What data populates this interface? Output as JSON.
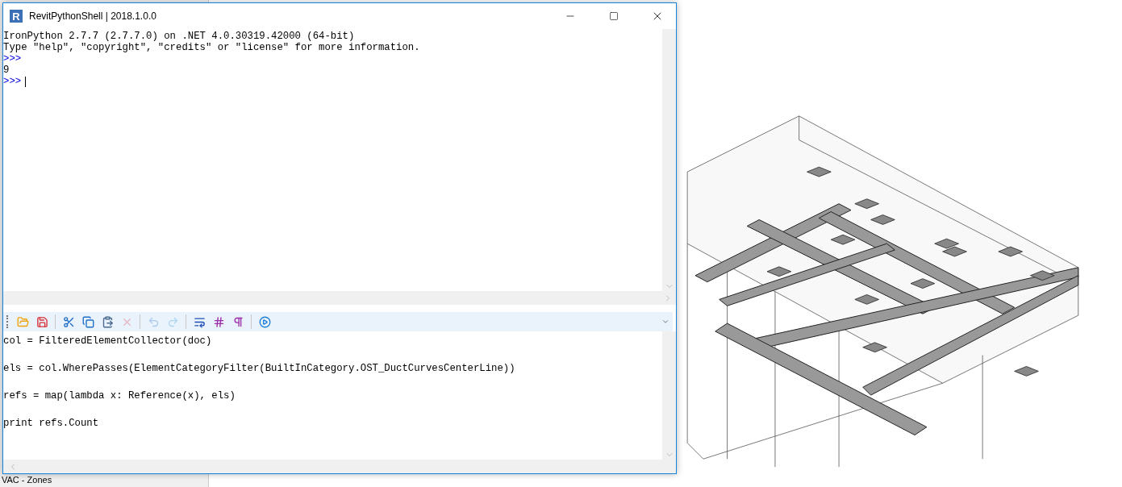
{
  "window": {
    "logo": "R",
    "title": "RevitPythonShell | 2018.1.0.0"
  },
  "output": [
    {
      "kind": "text",
      "text": "IronPython 2.7.7 (2.7.7.0) on .NET 4.0.30319.42000 (64-bit)"
    },
    {
      "kind": "text",
      "text": "Type \"help\", \"copyright\", \"credits\" or \"license\" for more information."
    },
    {
      "kind": "prompt",
      "text": ">>>"
    },
    {
      "kind": "text",
      "text": "9"
    },
    {
      "kind": "prompt",
      "text": ">>>"
    }
  ],
  "toolbar": [
    {
      "kind": "open",
      "disabled": false
    },
    {
      "kind": "save",
      "disabled": false
    },
    {
      "kind": "sep"
    },
    {
      "kind": "cut",
      "disabled": false
    },
    {
      "kind": "copy",
      "disabled": false
    },
    {
      "kind": "paste",
      "disabled": false
    },
    {
      "kind": "delete",
      "disabled": true
    },
    {
      "kind": "sep"
    },
    {
      "kind": "undo",
      "disabled": true
    },
    {
      "kind": "redo",
      "disabled": true
    },
    {
      "kind": "sep"
    },
    {
      "kind": "wrap",
      "disabled": false
    },
    {
      "kind": "hash",
      "disabled": false
    },
    {
      "kind": "pilcrow",
      "disabled": false
    },
    {
      "kind": "sep"
    },
    {
      "kind": "run",
      "disabled": false
    }
  ],
  "editor": {
    "lines": [
      "col = FilteredElementCollector(doc)",
      "els = col.WherePasses(ElementCategoryFilter(BuiltInCategory.OST_DuctCurvesCenterLine))",
      "refs = map(lambda x: Reference(x), els)",
      "print refs.Count"
    ]
  },
  "background": {
    "label": "VAC - Zones"
  }
}
